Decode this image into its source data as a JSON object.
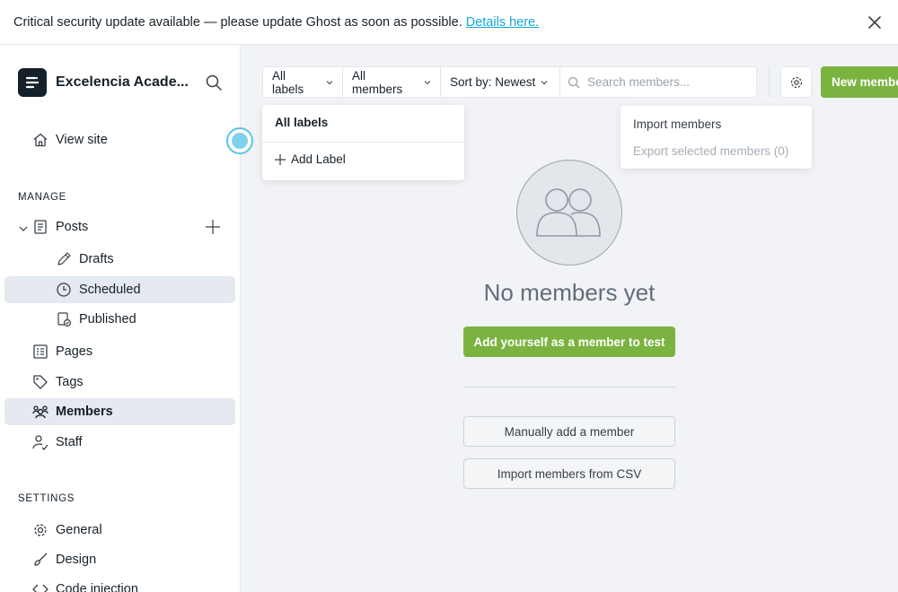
{
  "banner": {
    "message": "Critical security update available — please update Ghost as soon as possible.",
    "link_text": "Details here."
  },
  "sidebar": {
    "site_name": "Excelencia Acade...",
    "view_site": "View site",
    "manage_title": "MANAGE",
    "posts": "Posts",
    "drafts": "Drafts",
    "scheduled": "Scheduled",
    "published": "Published",
    "pages": "Pages",
    "tags": "Tags",
    "members": "Members",
    "staff": "Staff",
    "settings_title": "SETTINGS",
    "general": "General",
    "design": "Design",
    "code_injection": "Code injection"
  },
  "toolbar": {
    "labels_filter": "All labels",
    "members_filter": "All members",
    "sort": "Sort by: Newest",
    "search_placeholder": "Search members...",
    "new_member": "New member"
  },
  "labels_menu": {
    "header": "All labels",
    "add_label": "Add Label"
  },
  "actions_menu": {
    "import": "Import members",
    "export": "Export selected members (0)"
  },
  "empty": {
    "title": "No members yet",
    "add_self": "Add yourself as a member to test",
    "manual_add": "Manually add a member",
    "import_csv": "Import members from CSV"
  },
  "colors": {
    "accent_green": "#7bb340",
    "link_blue": "#14a7d6",
    "active_bg": "#e5e9f0"
  }
}
